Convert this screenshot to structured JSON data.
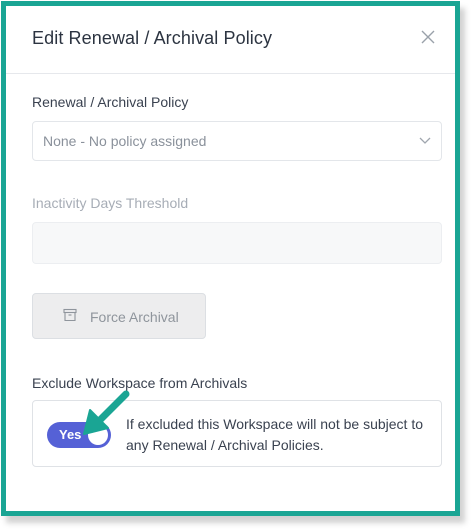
{
  "dialog": {
    "title": "Edit Renewal / Archival Policy",
    "close_icon": "close-icon"
  },
  "policy": {
    "label": "Renewal / Archival Policy",
    "selected_value": "None - No policy assigned"
  },
  "threshold": {
    "label": "Inactivity Days Threshold",
    "value": ""
  },
  "force_archival": {
    "label": "Force Archival",
    "icon": "archive-box-icon"
  },
  "exclude": {
    "label": "Exclude Workspace from Archivals",
    "toggle_label": "Yes",
    "toggle_on": true,
    "description": "If excluded this Workspace will not be subject to any Renewal / Archival Policies."
  },
  "colors": {
    "frame": "#1aa594",
    "toggle": "#5561d6",
    "callout_arrow": "#1aa594"
  }
}
